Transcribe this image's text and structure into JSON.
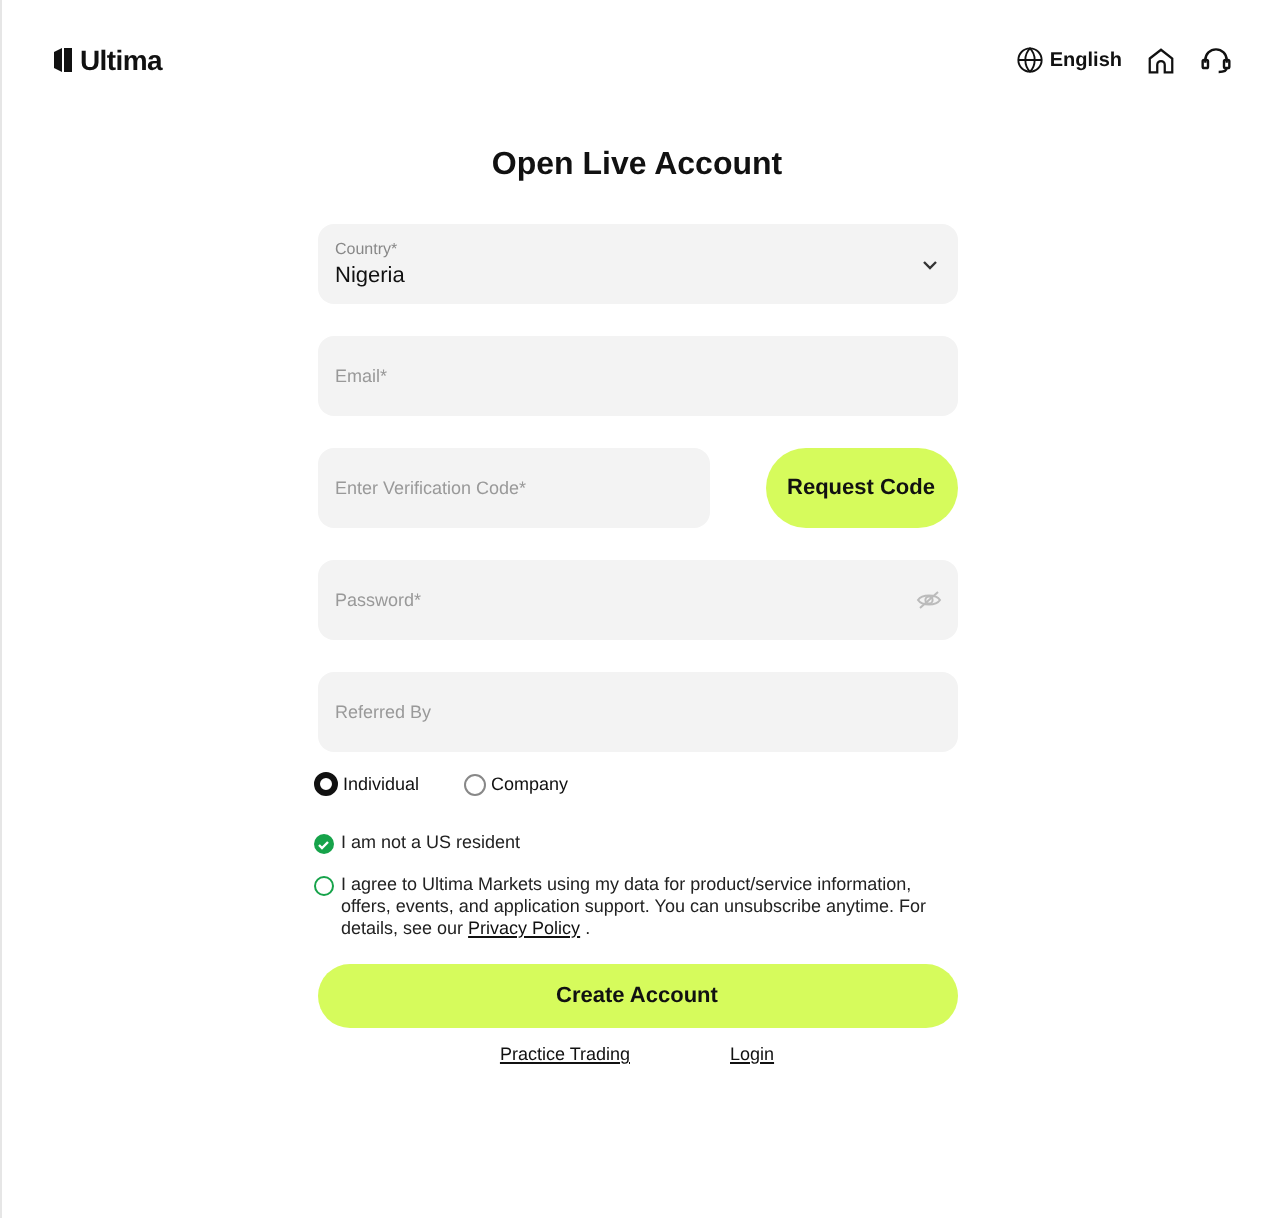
{
  "header": {
    "logo": "Ultima",
    "language": "English"
  },
  "title": "Open Live Account",
  "country": {
    "label": "Country*",
    "value": "Nigeria"
  },
  "email": {
    "placeholder": "Email*"
  },
  "verification": {
    "placeholder": "Enter Verification Code*",
    "button": "Request Code"
  },
  "password": {
    "placeholder": "Password*"
  },
  "referral": {
    "placeholder": "Referred By"
  },
  "account_types": [
    {
      "label": "Individual",
      "selected": true
    },
    {
      "label": "Company",
      "selected": false
    }
  ],
  "consents": [
    {
      "text": "I am not a US resident",
      "checked": true
    },
    {
      "text": "I agree to Ultima Markets using my data for product/service information, offers, events, and application support. You can unsubscribe anytime. For details, see our ",
      "link": "Privacy Policy",
      "after": " .",
      "checked": false
    }
  ],
  "submit": "Create Account",
  "links": [
    "Practice Trading",
    "Login"
  ]
}
